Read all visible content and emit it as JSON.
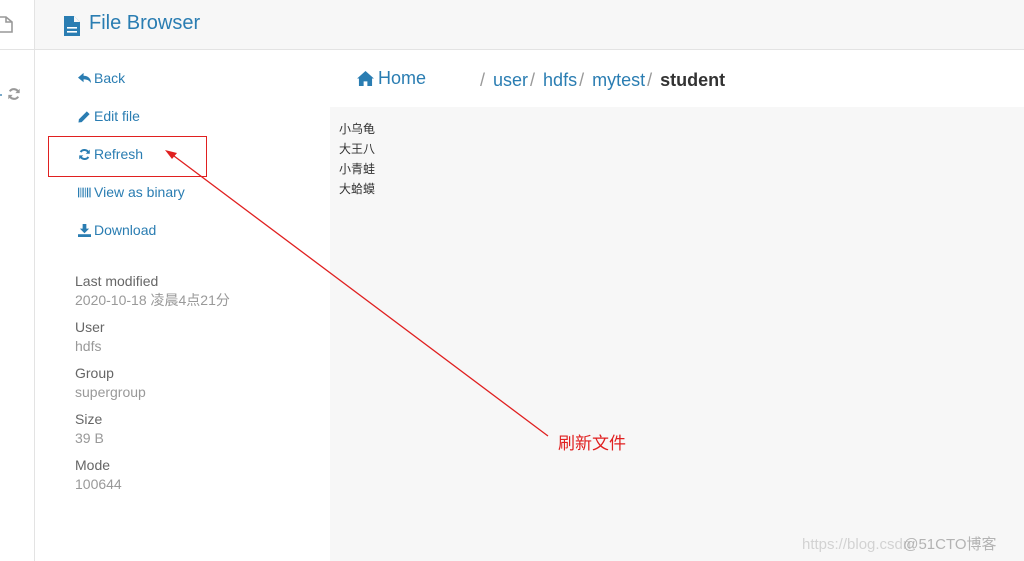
{
  "header": {
    "title": "File Browser",
    "icon": "file-icon"
  },
  "actions": [
    {
      "label": "Back",
      "icon": "reply-icon"
    },
    {
      "label": "Edit file",
      "icon": "pencil-icon"
    },
    {
      "label": "Refresh",
      "icon": "refresh-icon"
    },
    {
      "label": "View as binary",
      "icon": "barcode-icon"
    },
    {
      "label": "Download",
      "icon": "download-icon"
    }
  ],
  "metadata": [
    {
      "label": "Last modified",
      "value": "2020-10-18 凌晨4点21分"
    },
    {
      "label": "User",
      "value": "hdfs"
    },
    {
      "label": "Group",
      "value": "supergroup"
    },
    {
      "label": "Size",
      "value": "39 B"
    },
    {
      "label": "Mode",
      "value": "100644"
    }
  ],
  "breadcrumb": {
    "home": "Home",
    "separator": "/",
    "links": [
      "user",
      "hdfs",
      "mytest"
    ],
    "current": "student"
  },
  "file_content": [
    "小乌龟",
    "大王八",
    "小青蛙",
    "大蛤蟆"
  ],
  "annotation": {
    "label": "刷新文件",
    "color": "#e02020"
  },
  "watermark": {
    "text1": "https://blog.csdn",
    "text2": "@51CTO博客"
  },
  "colors": {
    "accent": "#2a7db2",
    "annotation": "#e02020"
  }
}
